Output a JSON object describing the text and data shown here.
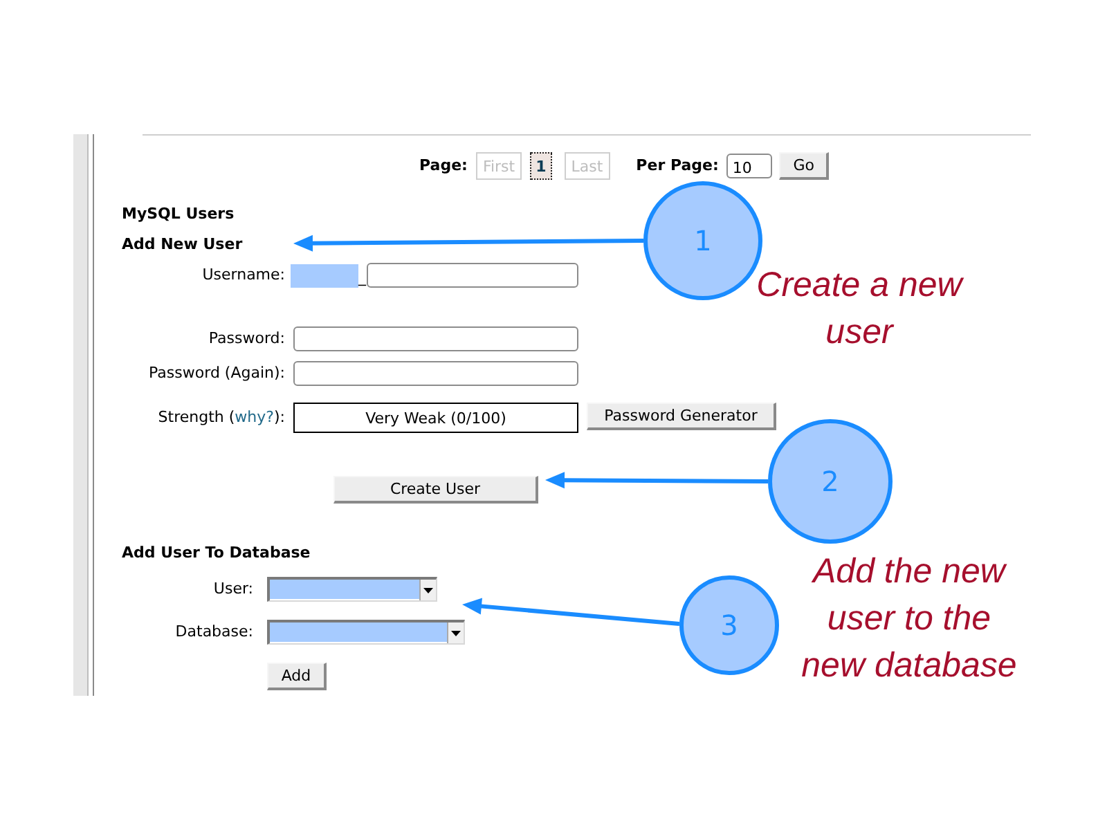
{
  "pagination": {
    "label": "Page:",
    "pages": [
      {
        "label": "First",
        "disabled": true,
        "selected": false
      },
      {
        "label": "1",
        "disabled": false,
        "selected": true
      },
      {
        "label": "Last",
        "disabled": true,
        "selected": false
      }
    ],
    "per_page": {
      "label": "Per Page:",
      "value": "10"
    },
    "go_button": "Go"
  },
  "section_title": "MySQL Users",
  "add_new_user": {
    "title": "Add New User",
    "fields": [
      {
        "kind": "username",
        "label": "Username:",
        "separator": "_"
      },
      {
        "kind": "password",
        "label": "Password:"
      },
      {
        "kind": "password",
        "label": "Password (Again):"
      },
      {
        "kind": "strength",
        "label": "Strength (",
        "link": "why?",
        "label_end": "):",
        "reading": "Very Weak (0/100)",
        "button": "Password Generator"
      }
    ],
    "submit_button": "Create User"
  },
  "add_user_to_database": {
    "title": "Add User To Database",
    "selects": [
      {
        "label": "User:"
      },
      {
        "label": "Database:"
      }
    ],
    "button": "Add"
  },
  "callouts": [
    {
      "number": "1",
      "note": [
        "Create a new",
        "user"
      ]
    },
    {
      "number": "2"
    },
    {
      "number": "3",
      "note": [
        "Add the new",
        "user to the",
        "new database"
      ]
    }
  ]
}
